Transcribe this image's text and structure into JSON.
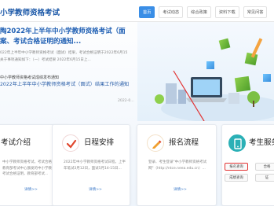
{
  "header": {
    "site_title": "小学教师资格考试",
    "nav": [
      {
        "label": "首页",
        "active": true
      },
      {
        "label": "考试动态",
        "active": false
      },
      {
        "label": "综合政策",
        "active": false
      },
      {
        "label": "资料下载",
        "active": false
      },
      {
        "label": "常见问答",
        "active": false
      }
    ]
  },
  "news": {
    "headline_line1": "陶2022年上半年中小学教师资格考试（面",
    "headline_line2": "案、考试合格证明的通知...",
    "snippet_line1": "022年上半年中小学教师资格考试（面试）结果，考试合格证明于2022年6月15",
    "snippet_line2": "关于事项通知如下：（一）考试结果  2022年6月15日上...",
    "link1": "中小学教师资格考试成绩发布通知",
    "link2": "2022年上半年中小学教师资格考试（面试）结果工作的通知",
    "link2_date": "2022-0..."
  },
  "cards": [
    {
      "title": "考试介绍",
      "text": "中小学教师资格考试，考试合格，颁发教育部考试中心颁发的中小学教师资格考试合格证明，教育部考试...",
      "more": "详情>>"
    },
    {
      "title": "日程安排",
      "text": "2022年中小学教师资格考试日程，上半年笔试3月12日，面试5月14-15日...",
      "more": "详情>>"
    },
    {
      "title": "报名流程",
      "text": "登录、考生登录\"中小学教师资格考试网\"（http://ntce.neea.edu.cn）...",
      "more": "详情>>"
    },
    {
      "title": "考生服务",
      "buttons": [
        "报名查询",
        "合格",
        "成绩查询",
        "证"
      ]
    }
  ],
  "colors": {
    "brand": "#1b58a8",
    "highlight": "#e23333",
    "nav_active": "#3a8ee6"
  }
}
